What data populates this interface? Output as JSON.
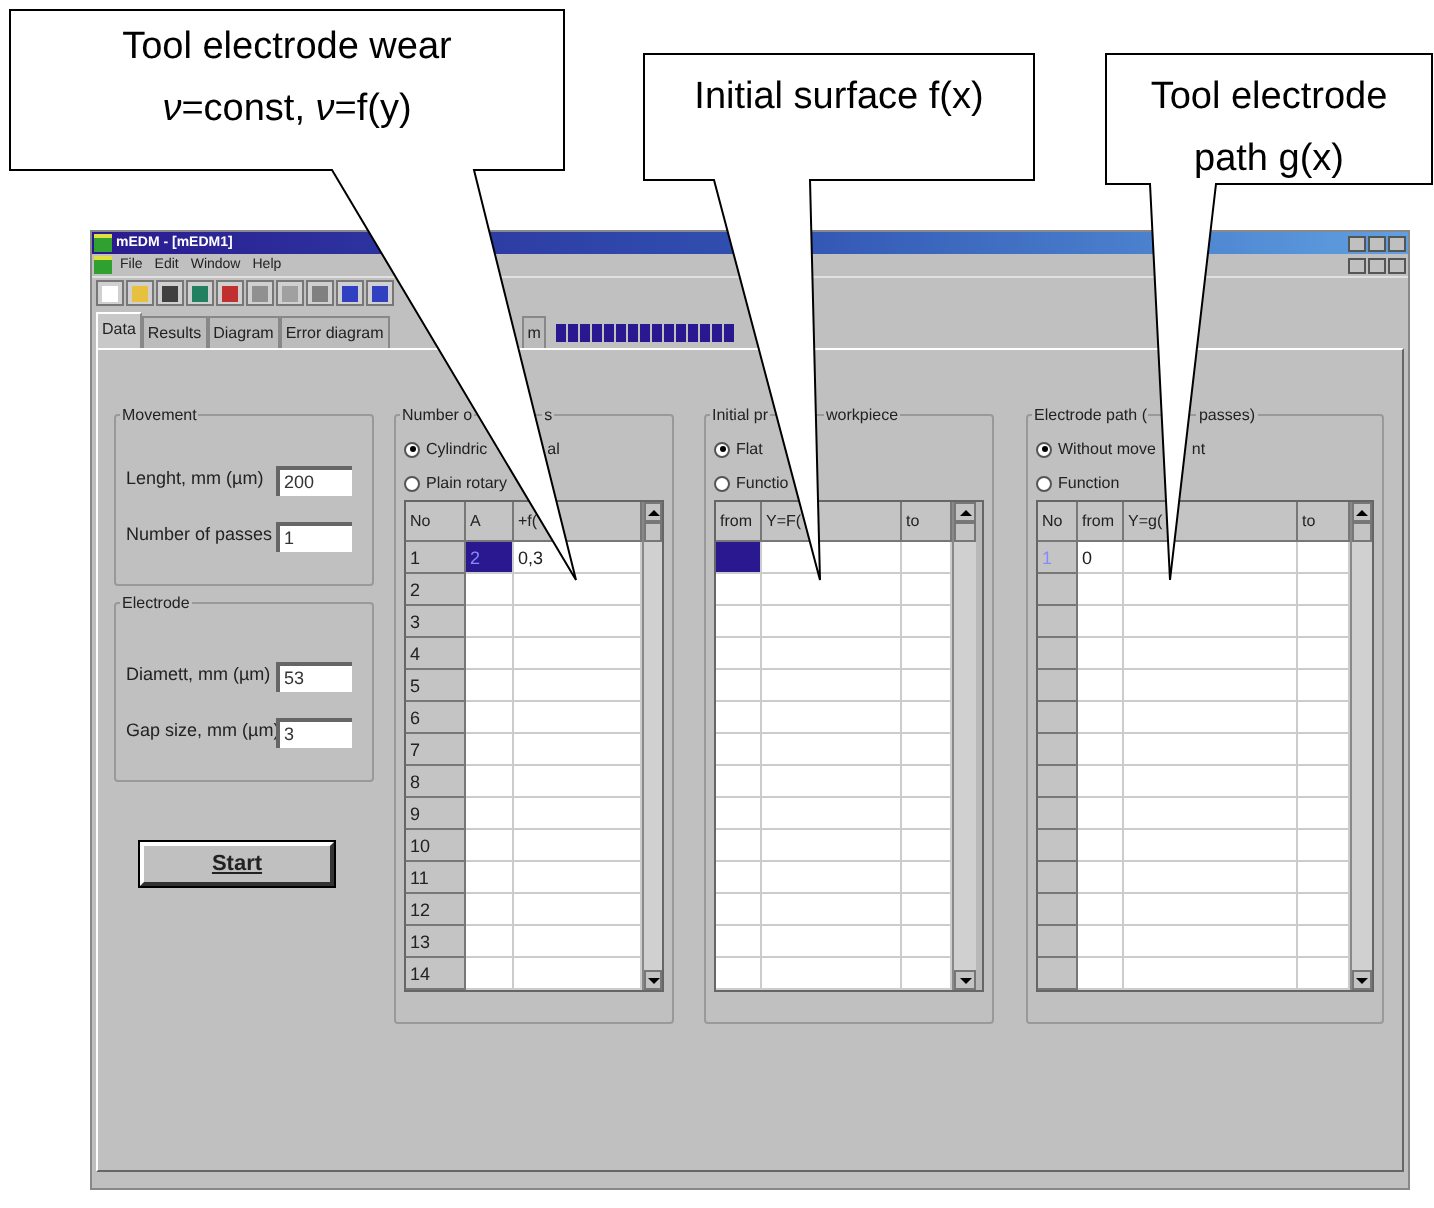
{
  "callouts": [
    {
      "lines": [
        "Tool electrode wear",
        "*ν*=const, *ν*=f(y)"
      ]
    },
    {
      "lines": [
        "Initial surface f(x)"
      ]
    },
    {
      "lines": [
        "Tool electrode",
        "path g(x)"
      ]
    }
  ],
  "window": {
    "title": "mEDM - [mEDM1]",
    "menu": [
      "File",
      "Edit",
      "Window",
      "Help"
    ]
  },
  "tabs": [
    {
      "label": "Data",
      "selected": true
    },
    {
      "label": "Results",
      "selected": false
    },
    {
      "label": "Diagram",
      "selected": false
    },
    {
      "label": "Error diagram",
      "selected": false
    },
    {
      "label": "m",
      "selected": false
    }
  ],
  "movement": {
    "title": "Movement",
    "fields": [
      {
        "label": "Lenght, mm (µm)",
        "value": "200"
      },
      {
        "label": "Number of passes",
        "value": "1"
      }
    ]
  },
  "electrode": {
    "title": "Electrode",
    "fields": [
      {
        "label": "Diamett, mm (µm)",
        "value": "53"
      },
      {
        "label": "Gap size, mm (µm)",
        "value": "3"
      }
    ]
  },
  "start_button": "Start",
  "wear": {
    "title": [
      "Number o",
      "s"
    ],
    "radios": [
      {
        "label": [
          "Cylindric",
          "al"
        ],
        "selected": true
      },
      {
        "label": [
          "Plain rotary"
        ],
        "selected": false
      }
    ],
    "columns": [
      "No",
      "A",
      "+f("
    ],
    "rows": [
      [
        "1",
        "2",
        "0,3"
      ],
      [
        "2"
      ],
      [
        "3"
      ],
      [
        "4"
      ],
      [
        "5"
      ],
      [
        "6"
      ],
      [
        "7"
      ],
      [
        "8"
      ],
      [
        "9"
      ],
      [
        "10"
      ],
      [
        "11"
      ],
      [
        "12"
      ],
      [
        "13"
      ],
      [
        "14"
      ]
    ]
  },
  "surface": {
    "title": [
      "Initial pr",
      "workpiece"
    ],
    "radios": [
      {
        "label": [
          "Flat"
        ],
        "selected": true
      },
      {
        "label": [
          "Functio"
        ],
        "selected": false
      }
    ],
    "columns": [
      "from",
      "Y=F(",
      "to"
    ]
  },
  "path": {
    "title": [
      "Electrode path (",
      "passes)"
    ],
    "radios": [
      {
        "label": [
          "Without move",
          "nt"
        ],
        "selected": true
      },
      {
        "label": [
          "Function"
        ],
        "selected": false
      }
    ],
    "columns": [
      "No",
      "from",
      "Y=g(",
      "to"
    ],
    "rows": [
      [
        "1",
        "0"
      ]
    ]
  }
}
